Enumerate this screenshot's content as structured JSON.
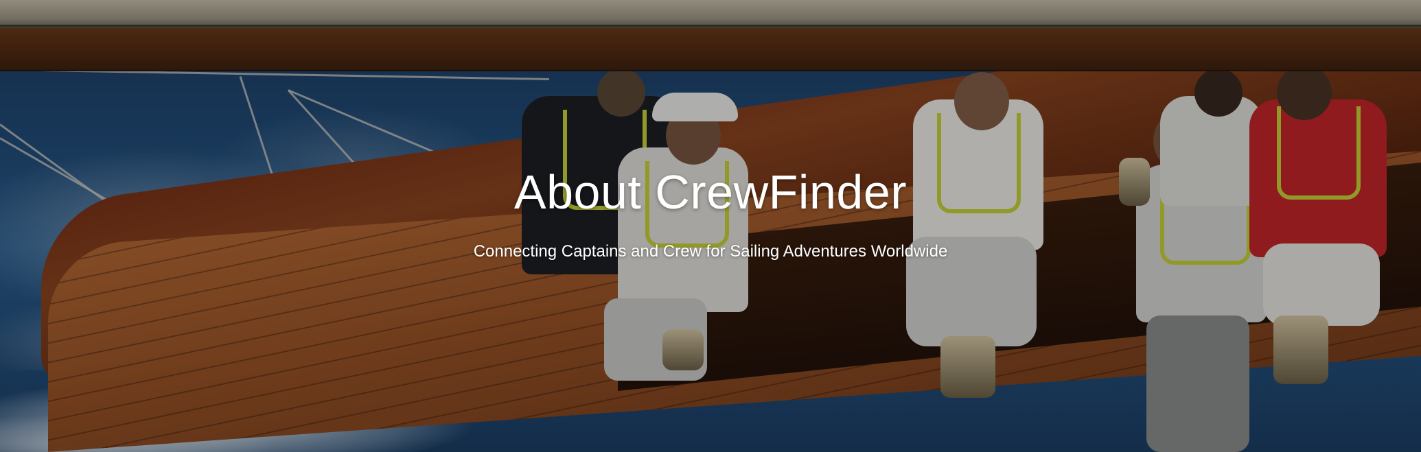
{
  "hero": {
    "title": "About CrewFinder",
    "subtitle": "Connecting Captains and Crew for Sailing Adventures Worldwide"
  },
  "colors": {
    "text": "#ffffff",
    "overlay": "rgba(0,0,0,0.28)",
    "sea": "#23507e",
    "deck_wood": "#9c5528",
    "lifejacket_strap": "#c9d63a",
    "red_jacket": "#c6262a"
  }
}
